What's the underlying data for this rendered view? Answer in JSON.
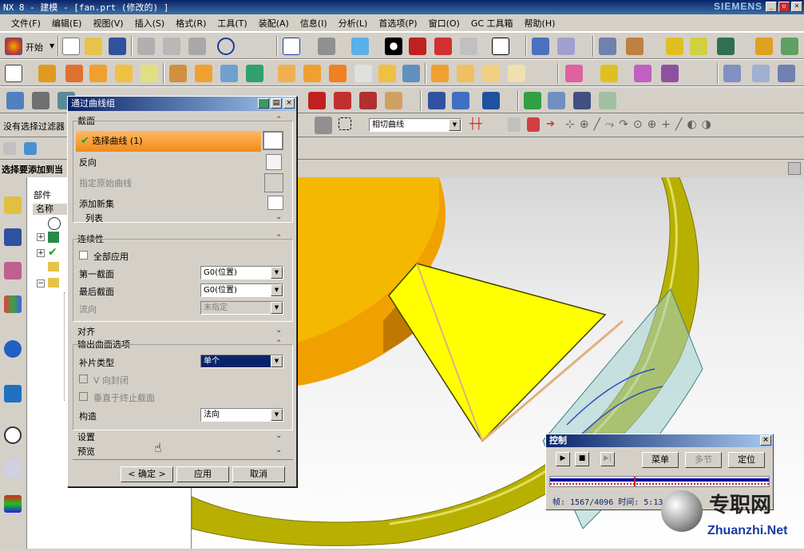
{
  "window": {
    "title": "NX 8 - 建模 - [fan.prt (修改的) ]",
    "brand": "SIEMENS"
  },
  "menu": [
    "文件(F)",
    "编辑(E)",
    "视图(V)",
    "插入(S)",
    "格式(R)",
    "工具(T)",
    "装配(A)",
    "信息(I)",
    "分析(L)",
    "首选项(P)",
    "窗口(O)",
    "GC 工具箱",
    "帮助(H)"
  ],
  "toolbar": {
    "start_label": "开始"
  },
  "filterbar": {
    "status": "没有选择过滤器",
    "snap_combo": "相切曲线"
  },
  "cue": {
    "text": "选择要添加到当"
  },
  "navigator": {
    "title": "部件",
    "column_name": "名称"
  },
  "dialog": {
    "title": "通过曲线组",
    "section_label": "截面",
    "select_curve": "选择曲线 (1)",
    "reverse": "反向",
    "specify_origin": "指定原始曲线",
    "add_new_set": "添加新集",
    "list": "列表",
    "continuity": "连续性",
    "apply_all": "全部应用",
    "first_section": "第一截面",
    "first_section_value": "G0(位置)",
    "last_section": "最后截面",
    "last_section_value": "G0(位置)",
    "flow_direction": "流向",
    "flow_direction_value": "未指定",
    "alignment": "对齐",
    "output_options": "输出曲面选项",
    "patch_type": "补片类型",
    "patch_type_value": "单个",
    "v_closed": "V 向封闭",
    "perp_to_end": "垂直于终止截面",
    "construction": "构造",
    "construction_value": "法向",
    "settings": "设置",
    "preview": "预览",
    "ok": "< 确定 >",
    "apply": "应用",
    "cancel": "取消"
  },
  "control": {
    "title": "控制",
    "menu_btn": "菜单",
    "multi_btn": "多节",
    "locate_btn": "定位",
    "status": "帧: 1567/4096 时间: 5:13:39"
  },
  "watermark": {
    "cn": "专职网",
    "en": "Zhuanzhi.Net"
  },
  "colors": {
    "accent": "#0a246a",
    "selected_row": "#f08a1a",
    "part_yellow": "#ffff00",
    "part_orange": "#f5a300",
    "ring_olive": "#b8b000"
  }
}
